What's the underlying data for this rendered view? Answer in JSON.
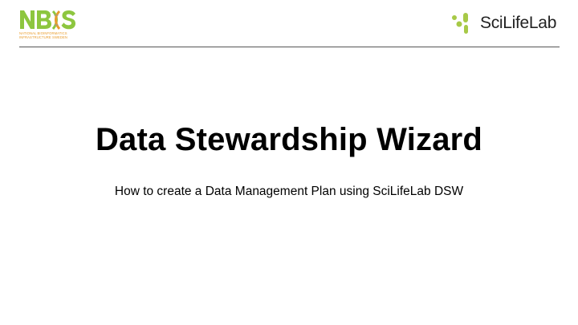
{
  "logos": {
    "nbis": {
      "wordmark": "NBIS",
      "caption_line1": "NATIONAL BIOINFORMATICS",
      "caption_line2": "INFRASTRUCTURE SWEDEN",
      "colors": {
        "green": "#8dc63f",
        "orange": "#e89c2c"
      },
      "icon": "dna-helix-icon"
    },
    "scilifelab": {
      "wordmark": "SciLifeLab",
      "colors": {
        "green": "#a7c947",
        "text": "#222222"
      },
      "icon": "scilifelab-dots-icon"
    }
  },
  "slide": {
    "title": "Data Stewardship Wizard",
    "subtitle": "How to create a Data Management Plan using SciLifeLab DSW"
  },
  "colors": {
    "background": "#ffffff",
    "rule": "#555555",
    "text": "#000000"
  }
}
